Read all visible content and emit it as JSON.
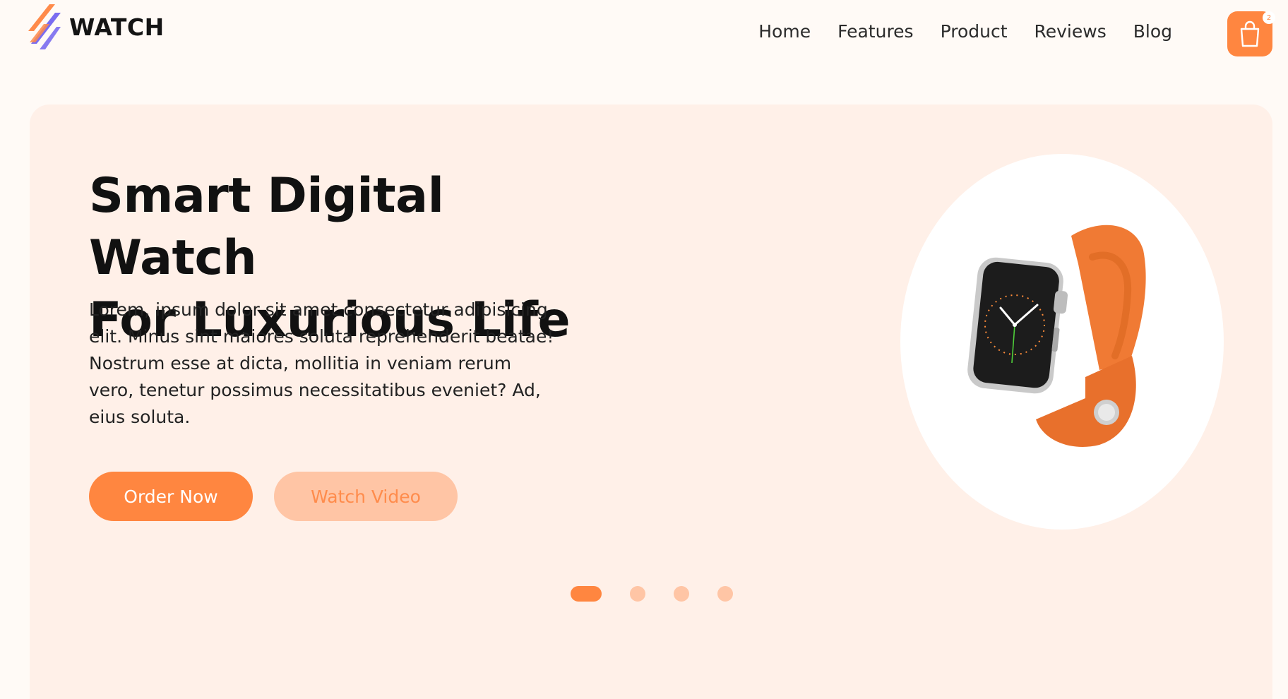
{
  "brand": {
    "name": "WATCH"
  },
  "nav": {
    "items": [
      "Home",
      "Features",
      "Product",
      "Reviews",
      "Blog"
    ]
  },
  "cart": {
    "count": "2"
  },
  "hero": {
    "title_line1": "Smart Digital Watch",
    "title_line2": "For Luxurious Life",
    "description": "Lorem, ipsum dolor sit amet consectetur adipisicing elit. Minus sint maiores soluta reprehenderit beatae! Nostrum esse at dicta, mollitia in veniam rerum vero, tenetur possimus necessitatibus eveniet? Ad, eius soluta.",
    "order_label": "Order Now",
    "video_label": "Watch Video"
  },
  "slider": {
    "count": 4,
    "active": 0
  },
  "colors": {
    "accent": "#ff8640",
    "accent_light": "#ffc5a5",
    "hero_bg": "#fff0e8",
    "page_bg": "#fffaf6"
  },
  "icons": {
    "logo": "stripes-logo-icon",
    "cart": "shopping-bag-icon",
    "product": "smartwatch-image"
  }
}
